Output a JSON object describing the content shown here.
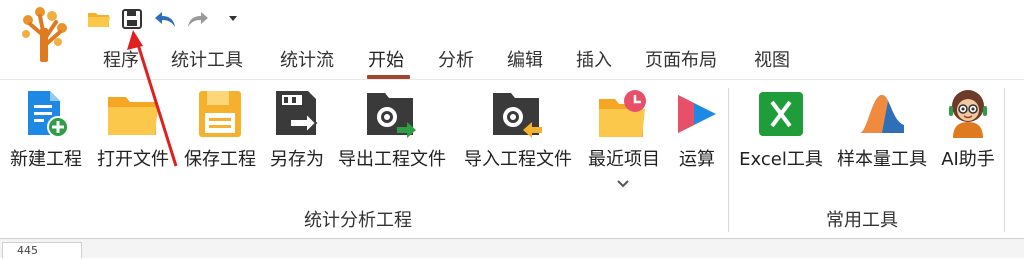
{
  "quick_access": {
    "items": [
      {
        "icon": "open-folder-icon"
      },
      {
        "icon": "save-icon"
      },
      {
        "icon": "undo-icon"
      },
      {
        "icon": "redo-icon"
      },
      {
        "icon": "dropdown-icon"
      }
    ]
  },
  "menu": {
    "tabs": [
      {
        "label": "程序"
      },
      {
        "label": "统计工具"
      },
      {
        "label": "统计流"
      },
      {
        "label": "开始"
      },
      {
        "label": "分析"
      },
      {
        "label": "编辑"
      },
      {
        "label": "插入"
      },
      {
        "label": "页面布局"
      },
      {
        "label": "视图"
      }
    ],
    "active": "开始"
  },
  "ribbon": {
    "group1": {
      "label": "统计分析工程",
      "buttons": [
        {
          "label": "新建工程",
          "icon": "new-project-icon"
        },
        {
          "label": "打开文件",
          "icon": "open-file-icon"
        },
        {
          "label": "保存工程",
          "icon": "save-project-icon"
        },
        {
          "label": "另存为",
          "icon": "save-as-icon"
        },
        {
          "label": "导出工程文件",
          "icon": "export-project-icon"
        },
        {
          "label": "导入工程文件",
          "icon": "import-project-icon"
        },
        {
          "label": "最近项目",
          "icon": "recent-projects-icon"
        },
        {
          "label": "运算",
          "icon": "run-icon"
        }
      ]
    },
    "group2": {
      "label": "常用工具",
      "buttons": [
        {
          "label": "Excel工具",
          "icon": "excel-icon"
        },
        {
          "label": "样本量工具",
          "icon": "sample-size-icon"
        },
        {
          "label": "AI助手",
          "icon": "ai-assistant-icon"
        }
      ]
    }
  },
  "colors": {
    "accent_underline": "#a0462f",
    "folder": "#f5b12e",
    "blue": "#1e88e5",
    "excel_green": "#1f9d3a",
    "dark_icon": "#3a3a3a",
    "annotation_arrow": "#e02020"
  },
  "lower_tab": {
    "label": "445"
  }
}
